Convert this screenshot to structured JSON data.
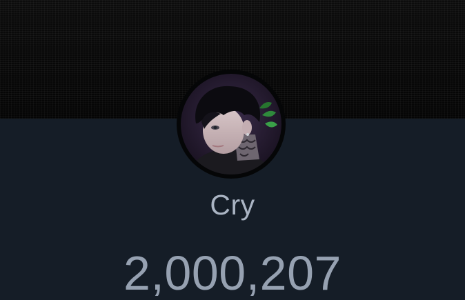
{
  "channel": {
    "name": "Cry",
    "subscriber_count": "2,000,207"
  },
  "colors": {
    "background": "#151d27",
    "banner": "#060606",
    "text": "#aab4c3"
  }
}
